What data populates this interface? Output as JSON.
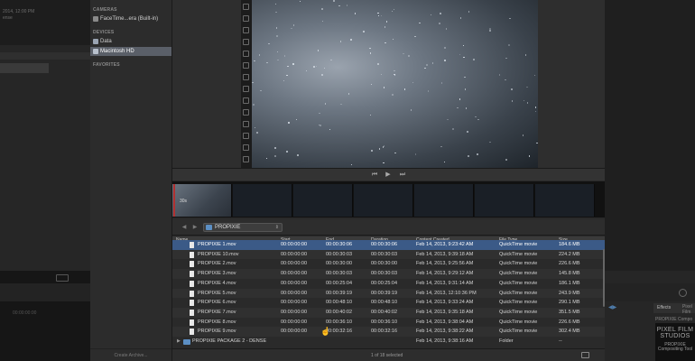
{
  "background_app": {
    "left_meta_line1": "2014, 12:00 PM",
    "left_meta_line2": "ense",
    "timeline_time": "00:00:00:00",
    "effects_tab": "Effects",
    "effects_tab2": "Pixel Film",
    "right_label": "PROPIXIE Compo",
    "logo_line1": "PIXEL FILM",
    "logo_line2": "STUDIOS",
    "logo_line3": "PROPIXIE",
    "logo_line4": "Compositing Tool"
  },
  "sidebar": {
    "cameras_heading": "CAMERAS",
    "camera_item": "FaceTime...era (Built-in)",
    "devices_heading": "DEVICES",
    "devices": [
      {
        "label": "Data",
        "selected": false
      },
      {
        "label": "Macintosh HD",
        "selected": true
      }
    ],
    "favorites_heading": "FAVORITES",
    "create_archive": "Create Archive..."
  },
  "viewer": {
    "transport": {
      "prev_icon": "skip-back-icon",
      "play_icon": "play-icon",
      "next_icon": "skip-forward-icon"
    }
  },
  "thumbnails": {
    "first_label": "30s"
  },
  "pathbar": {
    "back_arrow": "◀",
    "forward_arrow": "▶",
    "folder": "PROPIXIE"
  },
  "table": {
    "columns": {
      "name": "Name",
      "start": "Start",
      "end": "End",
      "duration": "Duration",
      "content_created": "Content Created",
      "file_type": "File Type",
      "size": "Size"
    },
    "rows": [
      {
        "name": "PROPIXIE 1.mov",
        "start": "00:00:00:00",
        "end": "00:00:30:06",
        "duration": "00:00:30:06",
        "created": "Feb 14, 2013, 9:23:42 AM",
        "type": "QuickTime movie",
        "size": "184.6 MB",
        "selected": true,
        "kind": "file"
      },
      {
        "name": "PROPIXIE 10.mov",
        "start": "00:00:00:00",
        "end": "00:00:30:03",
        "duration": "00:00:30:03",
        "created": "Feb 14, 2013, 9:39:18 AM",
        "type": "QuickTime movie",
        "size": "224.2 MB",
        "selected": false,
        "kind": "file"
      },
      {
        "name": "PROPIXIE 2.mov",
        "start": "00:00:00:00",
        "end": "00:00:30:00",
        "duration": "00:00:30:00",
        "created": "Feb 14, 2013, 9:25:56 AM",
        "type": "QuickTime movie",
        "size": "226.6 MB",
        "selected": false,
        "kind": "file"
      },
      {
        "name": "PROPIXIE 3.mov",
        "start": "00:00:00:00",
        "end": "00:00:30:03",
        "duration": "00:00:30:03",
        "created": "Feb 14, 2013, 9:29:12 AM",
        "type": "QuickTime movie",
        "size": "145.8 MB",
        "selected": false,
        "kind": "file"
      },
      {
        "name": "PROPIXIE 4.mov",
        "start": "00:00:00:00",
        "end": "00:00:25:04",
        "duration": "00:00:25:04",
        "created": "Feb 14, 2013, 9:31:14 AM",
        "type": "QuickTime movie",
        "size": "186.1 MB",
        "selected": false,
        "kind": "file"
      },
      {
        "name": "PROPIXIE 5.mov",
        "start": "00:00:00:00",
        "end": "00:00:39:19",
        "duration": "00:00:39:19",
        "created": "Feb 14, 2013, 12:10:36 PM",
        "type": "QuickTime movie",
        "size": "243.9 MB",
        "selected": false,
        "kind": "file"
      },
      {
        "name": "PROPIXIE 6.mov",
        "start": "00:00:00:00",
        "end": "00:00:48:10",
        "duration": "00:00:48:10",
        "created": "Feb 14, 2013, 9:33:24 AM",
        "type": "QuickTime movie",
        "size": "290.1 MB",
        "selected": false,
        "kind": "file"
      },
      {
        "name": "PROPIXIE 7.mov",
        "start": "00:00:00:00",
        "end": "00:00:40:02",
        "duration": "00:00:40:02",
        "created": "Feb 14, 2013, 9:35:18 AM",
        "type": "QuickTime movie",
        "size": "351.5 MB",
        "selected": false,
        "kind": "file"
      },
      {
        "name": "PROPIXIE 8.mov",
        "start": "00:00:00:00",
        "end": "00:00:36:10",
        "duration": "00:00:36:10",
        "created": "Feb 14, 2013, 9:38:04 AM",
        "type": "QuickTime movie",
        "size": "226.6 MB",
        "selected": false,
        "kind": "file"
      },
      {
        "name": "PROPIXIE 9.mov",
        "start": "00:00:00:00",
        "end": "00:00:32:16",
        "duration": "00:00:32:16",
        "created": "Feb 14, 2013, 9:38:22 AM",
        "type": "QuickTime movie",
        "size": "302.4 MB",
        "selected": false,
        "kind": "file"
      },
      {
        "name": "PROPIXIE PACKAGE 2 - DENSE",
        "start": "",
        "end": "",
        "duration": "",
        "created": "Feb 14, 2013, 9:38:16 AM",
        "type": "Folder",
        "size": "--",
        "selected": false,
        "kind": "folder"
      }
    ]
  },
  "footer": {
    "count": "1 of 18 selected"
  }
}
